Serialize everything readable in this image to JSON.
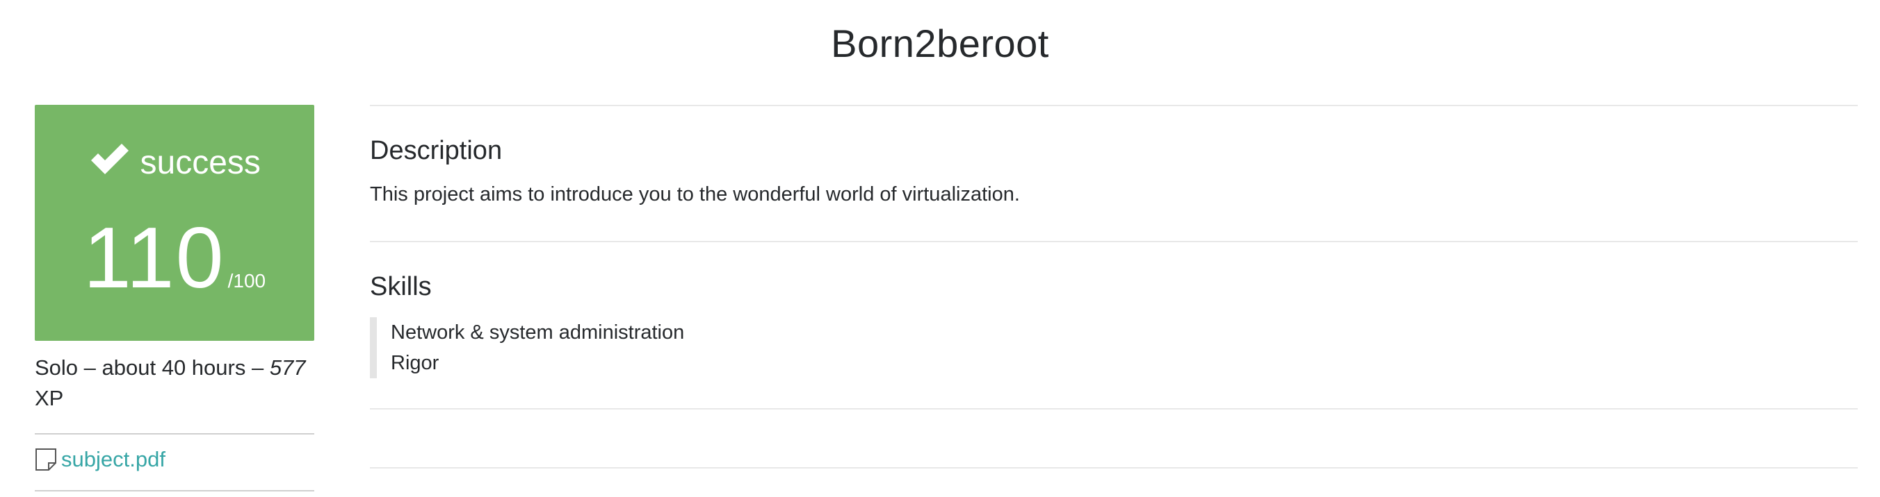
{
  "page": {
    "title": "Born2beroot"
  },
  "result": {
    "status": "success",
    "status_icon": "checkmark-icon",
    "score": "110",
    "score_max": "/100",
    "color": "#77b766"
  },
  "meta": {
    "prefix": "Solo – about 40 hours – ",
    "xp": "577",
    "xp_unit": " XP"
  },
  "attachment": {
    "icon": "document-icon",
    "label": "subject.pdf",
    "color": "#37a6a6"
  },
  "description": {
    "heading": "Description",
    "text": "This project aims to introduce you to the wonderful world of virtualization."
  },
  "skills": {
    "heading": "Skills",
    "items": [
      "Network & system administration",
      "Rigor"
    ]
  }
}
